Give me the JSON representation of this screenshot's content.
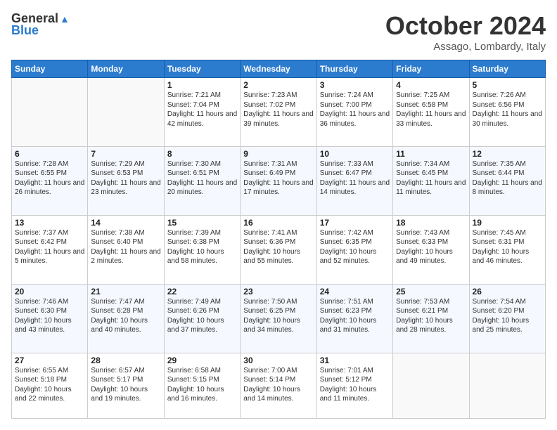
{
  "header": {
    "logo_general": "General",
    "logo_blue": "Blue",
    "month_title": "October 2024",
    "location": "Assago, Lombardy, Italy"
  },
  "days_of_week": [
    "Sunday",
    "Monday",
    "Tuesday",
    "Wednesday",
    "Thursday",
    "Friday",
    "Saturday"
  ],
  "weeks": [
    [
      {
        "day": "",
        "sunrise": "",
        "sunset": "",
        "daylight": ""
      },
      {
        "day": "",
        "sunrise": "",
        "sunset": "",
        "daylight": ""
      },
      {
        "day": "1",
        "sunrise": "Sunrise: 7:21 AM",
        "sunset": "Sunset: 7:04 PM",
        "daylight": "Daylight: 11 hours and 42 minutes."
      },
      {
        "day": "2",
        "sunrise": "Sunrise: 7:23 AM",
        "sunset": "Sunset: 7:02 PM",
        "daylight": "Daylight: 11 hours and 39 minutes."
      },
      {
        "day": "3",
        "sunrise": "Sunrise: 7:24 AM",
        "sunset": "Sunset: 7:00 PM",
        "daylight": "Daylight: 11 hours and 36 minutes."
      },
      {
        "day": "4",
        "sunrise": "Sunrise: 7:25 AM",
        "sunset": "Sunset: 6:58 PM",
        "daylight": "Daylight: 11 hours and 33 minutes."
      },
      {
        "day": "5",
        "sunrise": "Sunrise: 7:26 AM",
        "sunset": "Sunset: 6:56 PM",
        "daylight": "Daylight: 11 hours and 30 minutes."
      }
    ],
    [
      {
        "day": "6",
        "sunrise": "Sunrise: 7:28 AM",
        "sunset": "Sunset: 6:55 PM",
        "daylight": "Daylight: 11 hours and 26 minutes."
      },
      {
        "day": "7",
        "sunrise": "Sunrise: 7:29 AM",
        "sunset": "Sunset: 6:53 PM",
        "daylight": "Daylight: 11 hours and 23 minutes."
      },
      {
        "day": "8",
        "sunrise": "Sunrise: 7:30 AM",
        "sunset": "Sunset: 6:51 PM",
        "daylight": "Daylight: 11 hours and 20 minutes."
      },
      {
        "day": "9",
        "sunrise": "Sunrise: 7:31 AM",
        "sunset": "Sunset: 6:49 PM",
        "daylight": "Daylight: 11 hours and 17 minutes."
      },
      {
        "day": "10",
        "sunrise": "Sunrise: 7:33 AM",
        "sunset": "Sunset: 6:47 PM",
        "daylight": "Daylight: 11 hours and 14 minutes."
      },
      {
        "day": "11",
        "sunrise": "Sunrise: 7:34 AM",
        "sunset": "Sunset: 6:45 PM",
        "daylight": "Daylight: 11 hours and 11 minutes."
      },
      {
        "day": "12",
        "sunrise": "Sunrise: 7:35 AM",
        "sunset": "Sunset: 6:44 PM",
        "daylight": "Daylight: 11 hours and 8 minutes."
      }
    ],
    [
      {
        "day": "13",
        "sunrise": "Sunrise: 7:37 AM",
        "sunset": "Sunset: 6:42 PM",
        "daylight": "Daylight: 11 hours and 5 minutes."
      },
      {
        "day": "14",
        "sunrise": "Sunrise: 7:38 AM",
        "sunset": "Sunset: 6:40 PM",
        "daylight": "Daylight: 11 hours and 2 minutes."
      },
      {
        "day": "15",
        "sunrise": "Sunrise: 7:39 AM",
        "sunset": "Sunset: 6:38 PM",
        "daylight": "Daylight: 10 hours and 58 minutes."
      },
      {
        "day": "16",
        "sunrise": "Sunrise: 7:41 AM",
        "sunset": "Sunset: 6:36 PM",
        "daylight": "Daylight: 10 hours and 55 minutes."
      },
      {
        "day": "17",
        "sunrise": "Sunrise: 7:42 AM",
        "sunset": "Sunset: 6:35 PM",
        "daylight": "Daylight: 10 hours and 52 minutes."
      },
      {
        "day": "18",
        "sunrise": "Sunrise: 7:43 AM",
        "sunset": "Sunset: 6:33 PM",
        "daylight": "Daylight: 10 hours and 49 minutes."
      },
      {
        "day": "19",
        "sunrise": "Sunrise: 7:45 AM",
        "sunset": "Sunset: 6:31 PM",
        "daylight": "Daylight: 10 hours and 46 minutes."
      }
    ],
    [
      {
        "day": "20",
        "sunrise": "Sunrise: 7:46 AM",
        "sunset": "Sunset: 6:30 PM",
        "daylight": "Daylight: 10 hours and 43 minutes."
      },
      {
        "day": "21",
        "sunrise": "Sunrise: 7:47 AM",
        "sunset": "Sunset: 6:28 PM",
        "daylight": "Daylight: 10 hours and 40 minutes."
      },
      {
        "day": "22",
        "sunrise": "Sunrise: 7:49 AM",
        "sunset": "Sunset: 6:26 PM",
        "daylight": "Daylight: 10 hours and 37 minutes."
      },
      {
        "day": "23",
        "sunrise": "Sunrise: 7:50 AM",
        "sunset": "Sunset: 6:25 PM",
        "daylight": "Daylight: 10 hours and 34 minutes."
      },
      {
        "day": "24",
        "sunrise": "Sunrise: 7:51 AM",
        "sunset": "Sunset: 6:23 PM",
        "daylight": "Daylight: 10 hours and 31 minutes."
      },
      {
        "day": "25",
        "sunrise": "Sunrise: 7:53 AM",
        "sunset": "Sunset: 6:21 PM",
        "daylight": "Daylight: 10 hours and 28 minutes."
      },
      {
        "day": "26",
        "sunrise": "Sunrise: 7:54 AM",
        "sunset": "Sunset: 6:20 PM",
        "daylight": "Daylight: 10 hours and 25 minutes."
      }
    ],
    [
      {
        "day": "27",
        "sunrise": "Sunrise: 6:55 AM",
        "sunset": "Sunset: 5:18 PM",
        "daylight": "Daylight: 10 hours and 22 minutes."
      },
      {
        "day": "28",
        "sunrise": "Sunrise: 6:57 AM",
        "sunset": "Sunset: 5:17 PM",
        "daylight": "Daylight: 10 hours and 19 minutes."
      },
      {
        "day": "29",
        "sunrise": "Sunrise: 6:58 AM",
        "sunset": "Sunset: 5:15 PM",
        "daylight": "Daylight: 10 hours and 16 minutes."
      },
      {
        "day": "30",
        "sunrise": "Sunrise: 7:00 AM",
        "sunset": "Sunset: 5:14 PM",
        "daylight": "Daylight: 10 hours and 14 minutes."
      },
      {
        "day": "31",
        "sunrise": "Sunrise: 7:01 AM",
        "sunset": "Sunset: 5:12 PM",
        "daylight": "Daylight: 10 hours and 11 minutes."
      },
      {
        "day": "",
        "sunrise": "",
        "sunset": "",
        "daylight": ""
      },
      {
        "day": "",
        "sunrise": "",
        "sunset": "",
        "daylight": ""
      }
    ]
  ]
}
